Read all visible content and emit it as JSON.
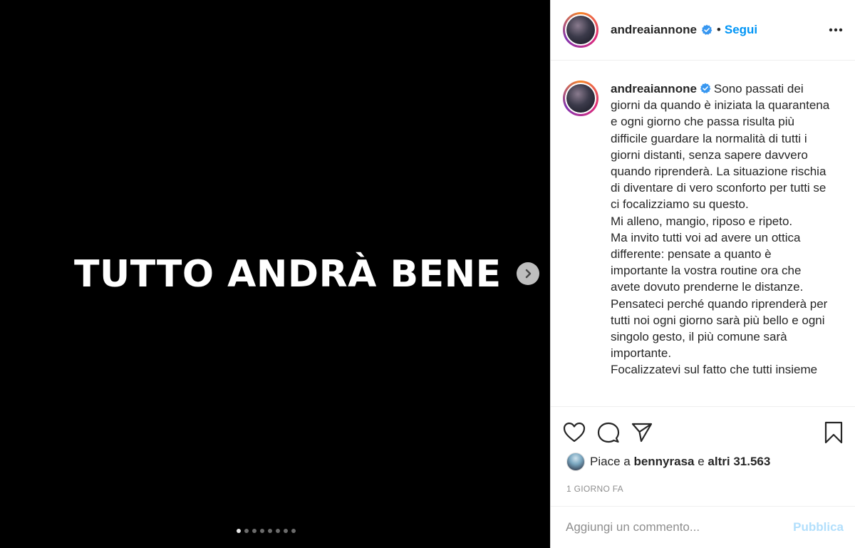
{
  "media": {
    "overlay_text": "TUTTO ANDRÀ BENE",
    "carousel_dots": 8,
    "active_dot": 0
  },
  "header": {
    "username": "andreaiannone",
    "separator": "•",
    "follow_label": "Segui"
  },
  "caption": {
    "username": "andreaiannone",
    "text": "Sono passati dei giorni da quando è iniziata la quarantena e ogni giorno che passa risulta più difficile guardare la normalità di tutti i giorni distanti, senza sapere davvero quando riprenderà. La situazione rischia di diventare di vero sconforto per tutti se ci focalizziamo su questo.\nMi alleno, mangio, riposo e ripeto.\nMa invito tutti voi ad avere un ottica differente: pensate a quanto è importante la vostra routine ora che avete dovuto prenderne le distanze.\nPensateci perché quando riprenderà per tutti noi ogni giorno sarà più bello e ogni singolo gesto, il più comune sarà importante.\nFocalizzatevi sul fatto che tutti insieme"
  },
  "likes": {
    "prefix": "Piace a",
    "user": "bennyrasa",
    "conj": "e",
    "others": "altri 31.563"
  },
  "timestamp": "1 GIORNO FA",
  "comment": {
    "placeholder": "Aggiungi un commento...",
    "publish_label": "Pubblica"
  },
  "colors": {
    "accent": "#0095f6",
    "publish_disabled": "#b2dffc",
    "verified": "#3897f0"
  }
}
